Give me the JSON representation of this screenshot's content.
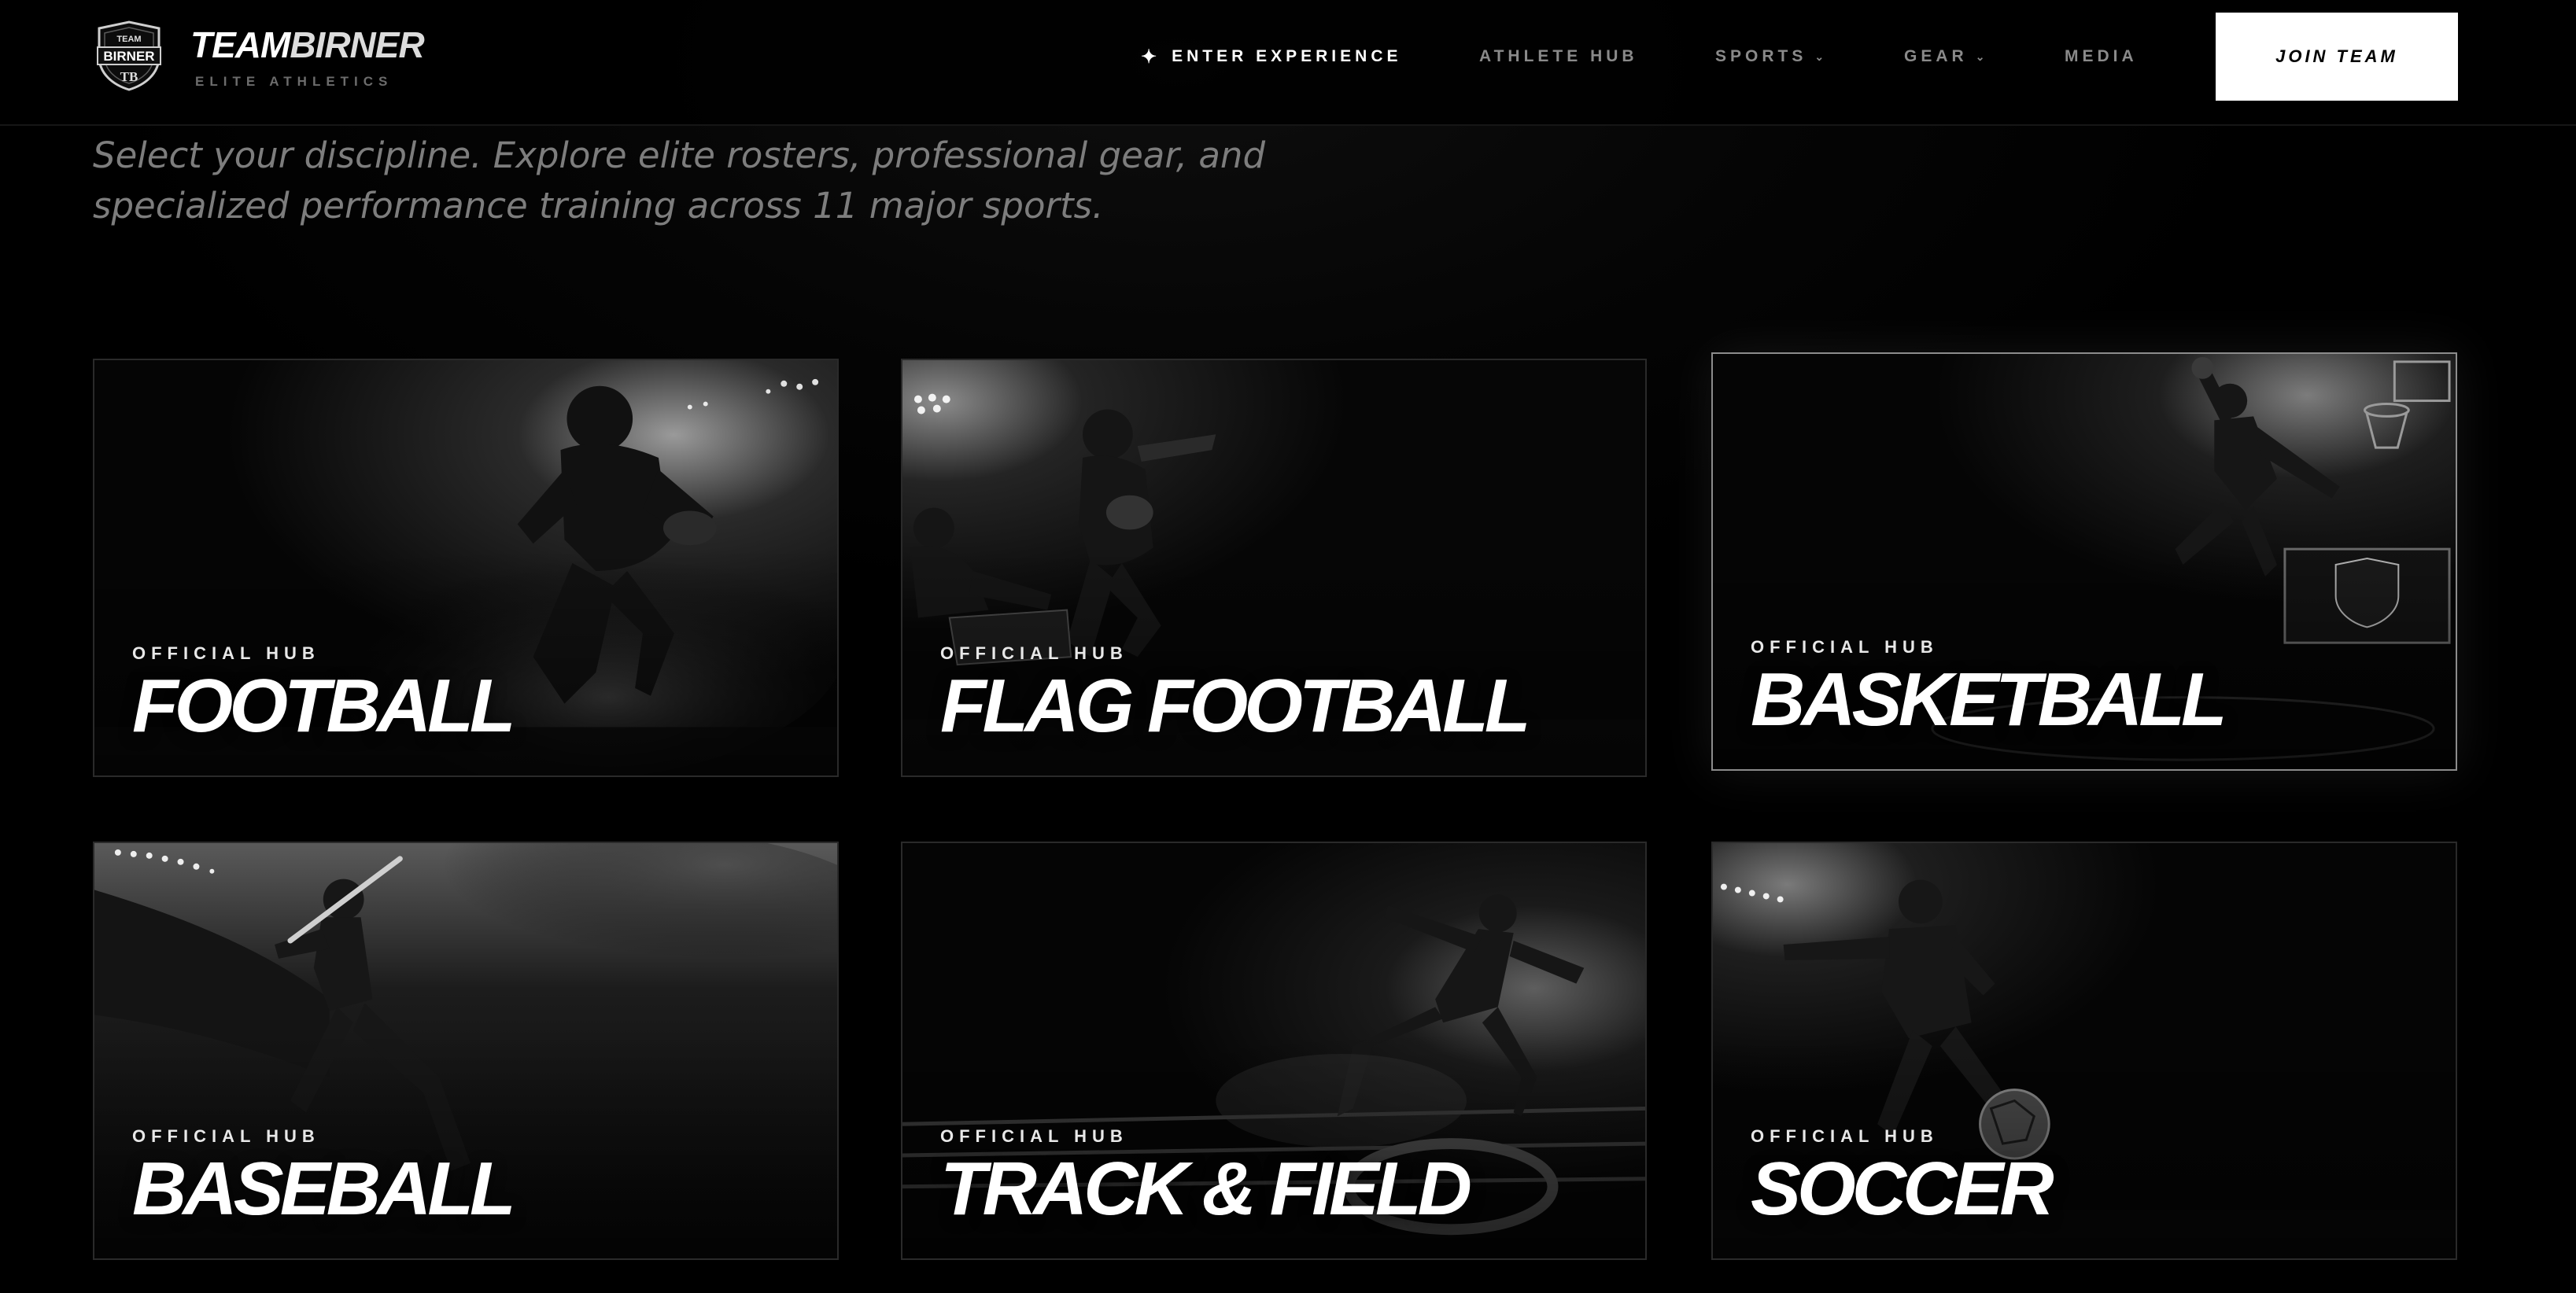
{
  "brand": {
    "name_bold": "TEAM",
    "name_light": "BIRNER",
    "tagline": "ELITE ATHLETICS",
    "shield_top": "TEAM",
    "shield_mid": "BIRNER",
    "shield_mono": "TB"
  },
  "nav": {
    "enter": "ENTER EXPERIENCE",
    "athlete_hub": "ATHLETE HUB",
    "sports": "SPORTS",
    "gear": "GEAR",
    "media": "MEDIA",
    "join": "JOIN TEAM"
  },
  "intro": "Select your discipline. Explore elite rosters, professional gear, and specialized performance training across 11 major sports.",
  "cards": [
    {
      "kicker": "OFFICIAL HUB",
      "title": "FOOTBALL"
    },
    {
      "kicker": "OFFICIAL HUB",
      "title": "FLAG FOOTBALL"
    },
    {
      "kicker": "OFFICIAL HUB",
      "title": "BASKETBALL"
    },
    {
      "kicker": "OFFICIAL HUB",
      "title": "BASEBALL"
    },
    {
      "kicker": "OFFICIAL HUB",
      "title": "TRACK & FIELD"
    },
    {
      "kicker": "OFFICIAL HUB",
      "title": "SOCCER"
    }
  ],
  "colors": {
    "background": "#000000",
    "accent": "#ffffff",
    "muted_text": "#7d7d7d"
  },
  "icons": [
    "shield-logo-icon",
    "sparkle-icon",
    "chevron-down-icon"
  ]
}
